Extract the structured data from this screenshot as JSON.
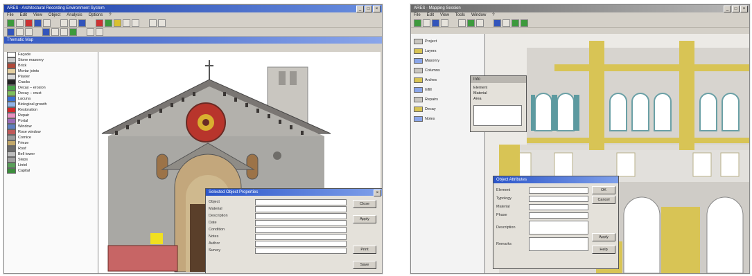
{
  "left_window": {
    "title": "ARES - Architectural Recording Environment System",
    "menu": [
      "File",
      "Edit",
      "View",
      "Object",
      "Analysis",
      "Options",
      "?"
    ],
    "sidebar_header": "Thematic Map",
    "layers": [
      {
        "label": "Façade",
        "color": "#ffffff"
      },
      {
        "label": "Stone masonry",
        "color": "#c9c9c9"
      },
      {
        "label": "Brick",
        "color": "#b04a3a"
      },
      {
        "label": "Mortar joints",
        "color": "#e4cfa0"
      },
      {
        "label": "Plaster",
        "color": "#d8d8d8"
      },
      {
        "label": "Cracks",
        "color": "#222222"
      },
      {
        "label": "Decay – erosion",
        "color": "#49a34a"
      },
      {
        "label": "Decay – crust",
        "color": "#7fbf5c"
      },
      {
        "label": "Lacuna",
        "color": "#3b6fd1"
      },
      {
        "label": "Biological growth",
        "color": "#8fb3e8"
      },
      {
        "label": "Restoration",
        "color": "#d12a2a"
      },
      {
        "label": "Repair",
        "color": "#e890c0"
      },
      {
        "label": "Portal",
        "color": "#9a6bb5"
      },
      {
        "label": "Window",
        "color": "#5d7fbf"
      },
      {
        "label": "Rose window",
        "color": "#c05a5a"
      },
      {
        "label": "Cornice",
        "color": "#9c9c9c"
      },
      {
        "label": "Frieze",
        "color": "#c2a86a"
      },
      {
        "label": "Roof",
        "color": "#6b6b6b"
      },
      {
        "label": "Bell tower",
        "color": "#bdbdbd"
      },
      {
        "label": "Steps",
        "color": "#a0a0a0"
      },
      {
        "label": "Lintel",
        "color": "#59a059"
      },
      {
        "label": "Capital",
        "color": "#3d8d3d"
      }
    ],
    "dialog": {
      "title": "Selected Object Properties",
      "fields": [
        "Object",
        "Material",
        "Description",
        "Date",
        "Condition",
        "Notes",
        "Author",
        "Survey"
      ],
      "buttons": [
        "Close",
        "Apply",
        "Print",
        "Save"
      ]
    }
  },
  "right_window": {
    "title": "ARES - Mapping Session",
    "menu": [
      "File",
      "Edit",
      "View",
      "Tools",
      "Window",
      "?"
    ],
    "tree": [
      {
        "label": "Project"
      },
      {
        "label": "Layers"
      },
      {
        "label": "Masonry"
      },
      {
        "label": "Columns"
      },
      {
        "label": "Arches"
      },
      {
        "label": "Infill"
      },
      {
        "label": "Repairs"
      },
      {
        "label": "Decay"
      },
      {
        "label": "Notes"
      }
    ],
    "small_dialog": {
      "title": "Info",
      "lines": [
        "Element",
        "Material",
        "Area"
      ]
    },
    "dialog": {
      "title": "Object Attributes",
      "fields": [
        "Element",
        "Typology",
        "Material",
        "Phase",
        "Description",
        "Remarks"
      ],
      "buttons": [
        "OK",
        "Cancel",
        "Apply",
        "Help"
      ]
    }
  }
}
